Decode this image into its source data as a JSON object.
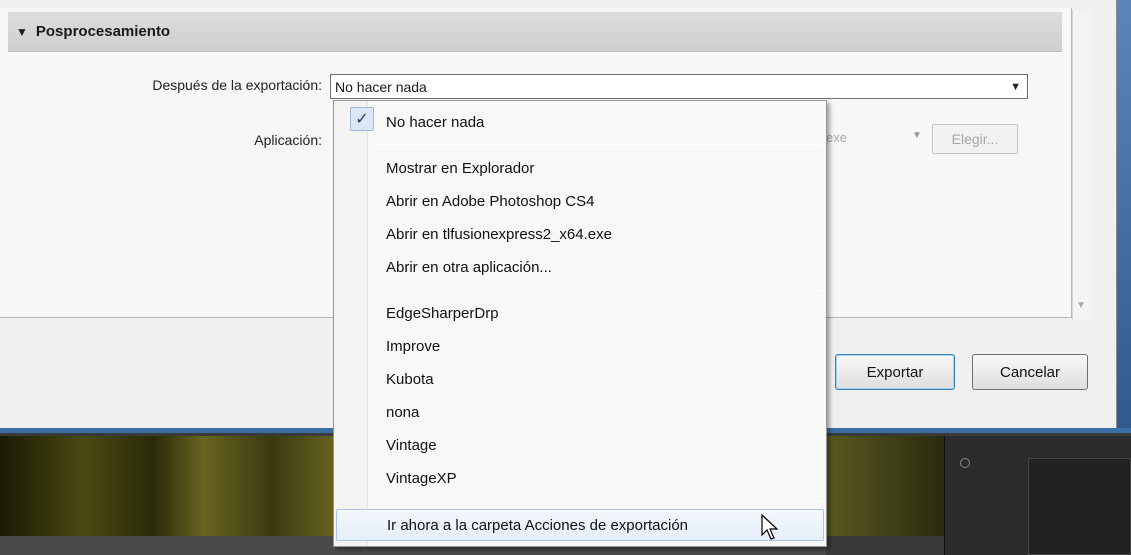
{
  "section": {
    "title": "Posprocesamiento"
  },
  "form": {
    "after_export_label": "Después de la exportación:",
    "after_export_value": "No hacer nada",
    "application_label": "Aplicación:",
    "application_value_fragment": "exe",
    "choose_button": "Elegir..."
  },
  "dialog_buttons": {
    "export": "Exportar",
    "cancel": "Cancelar"
  },
  "menu": {
    "group1": [
      "No hacer nada"
    ],
    "group2": [
      "Mostrar en Explorador",
      "Abrir en Adobe Photoshop CS4",
      "Abrir en tlfusionexpress2_x64.exe",
      "Abrir en otra aplicación..."
    ],
    "group3": [
      "EdgeSharperDrp",
      "Improve",
      "Kubota",
      "nona",
      "Vintage",
      "VintageXP"
    ],
    "group4": [
      "Ir ahora a la carpeta Acciones de exportación"
    ],
    "checked_item": "No hacer nada",
    "hovered_item": "Ir ahora a la carpeta Acciones de exportación"
  },
  "colors": {
    "accent": "#3c7fb1",
    "menu_hover": "#e6eef9",
    "dialog_bg": "#f0f0f0"
  },
  "icons": {
    "section_toggle": "triangle-down-icon",
    "select_arrow": "chevron-down-icon",
    "check": "checkmark-icon",
    "cursor": "mouse-pointer-icon"
  }
}
